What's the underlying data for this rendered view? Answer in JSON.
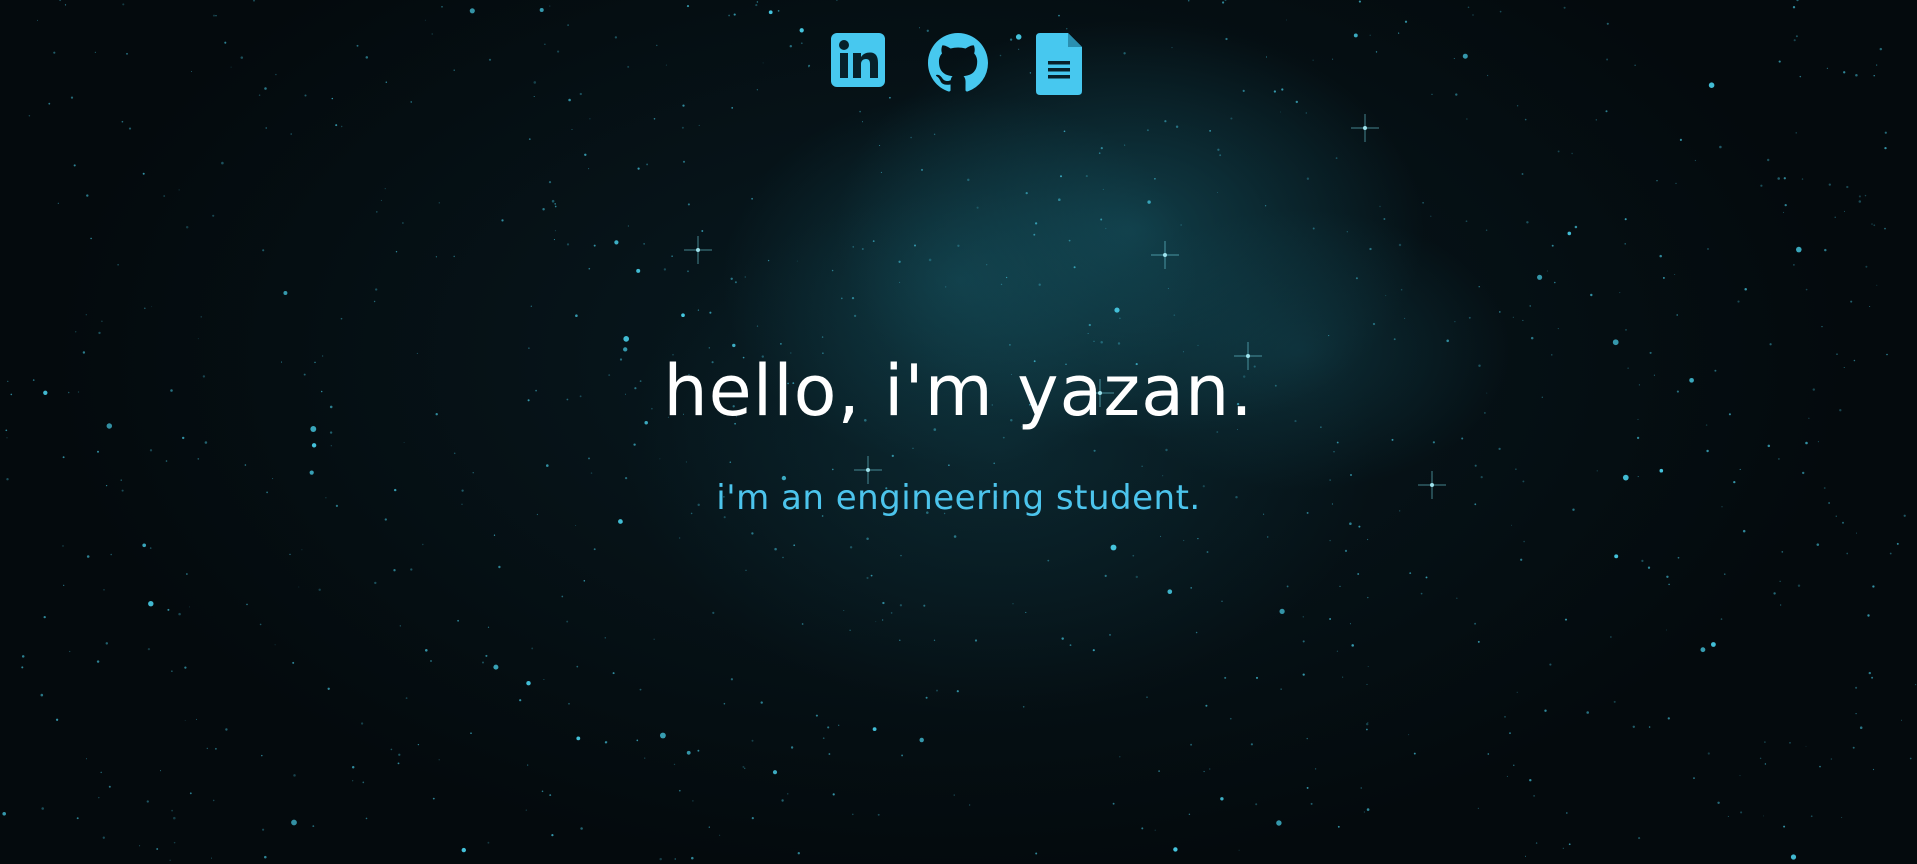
{
  "nav": {
    "links": [
      {
        "icon": "linkedin-icon"
      },
      {
        "icon": "github-icon"
      },
      {
        "icon": "document-icon"
      }
    ],
    "accent_color": "#47c8ef"
  },
  "hero": {
    "title": "hello, i'm yazan.",
    "subtitle": "i'm an engineering student."
  },
  "colors": {
    "background": "#05090c",
    "nebula": "#1f6f7d",
    "title": "#ffffff",
    "subtitle": "#4cc4ec"
  }
}
